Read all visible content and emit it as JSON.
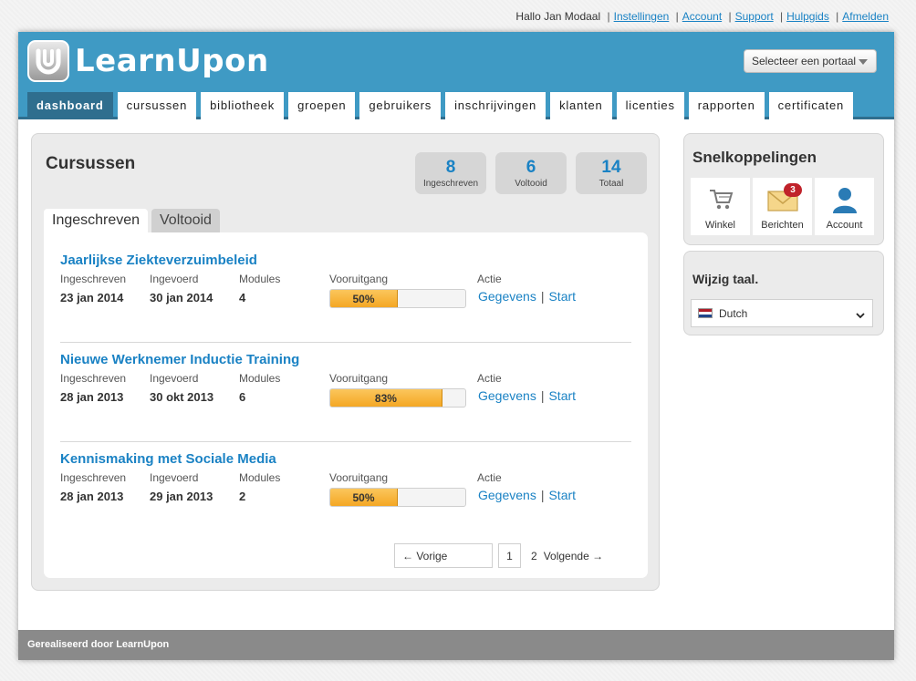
{
  "topbar": {
    "greeting": "Hallo Jan Modaal",
    "links": [
      "Instellingen",
      "Account",
      "Support",
      "Hulpgids",
      "Afmelden"
    ]
  },
  "header": {
    "logo_text": "LearnUpon",
    "portal_select": "Selecteer een portaal"
  },
  "nav": {
    "items": [
      "dashboard",
      "cursussen",
      "bibliotheek",
      "groepen",
      "gebruikers",
      "inschrijvingen",
      "klanten",
      "licenties",
      "rapporten",
      "certificaten"
    ],
    "active": "dashboard"
  },
  "courses_panel": {
    "title": "Cursussen",
    "stats": [
      {
        "value": "8",
        "label": "Ingeschreven"
      },
      {
        "value": "6",
        "label": "Voltooid"
      },
      {
        "value": "14",
        "label": "Totaal"
      }
    ],
    "tabs": [
      "Ingeschreven",
      "Voltooid"
    ],
    "columns": {
      "enrolled": "Ingeschreven",
      "entered": "Ingevoerd",
      "modules": "Modules",
      "progress": "Vooruitgang",
      "action": "Actie"
    },
    "actions": {
      "details": "Gegevens",
      "start": "Start"
    },
    "courses": [
      {
        "title": "Jaarlijkse Ziekteverzuimbeleid",
        "enrolled": "23 jan 2014",
        "entered": "30 jan 2014",
        "modules": "4",
        "progress_label": "50%",
        "progress": 0.5
      },
      {
        "title": "Nieuwe Werknemer Inductie Training",
        "enrolled": "28 jan 2013",
        "entered": "30 okt 2013",
        "modules": "6",
        "progress_label": "83%",
        "progress": 0.83
      },
      {
        "title": "Kennismaking met Sociale Media",
        "enrolled": "28 jan 2013",
        "entered": "29 jan 2013",
        "modules": "2",
        "progress_label": "50%",
        "progress": 0.5
      }
    ],
    "pagination": {
      "prev": "← Vorige",
      "page_current": "1",
      "page_next": "2",
      "next": "Volgende →"
    }
  },
  "shortcuts": {
    "title": "Snelkoppelingen",
    "items": [
      {
        "label": "Winkel",
        "icon": "cart-icon"
      },
      {
        "label": "Berichten",
        "icon": "envelope-icon",
        "badge": "3"
      },
      {
        "label": "Account",
        "icon": "user-icon"
      }
    ]
  },
  "language": {
    "title": "Wijzig taal.",
    "selected": "Dutch",
    "flag": "netherlands-flag-icon"
  },
  "footer": {
    "text": "Gerealiseerd door LearnUpon"
  },
  "colors": {
    "brand_blue": "#3f9ac4",
    "nav_active": "#2f6e8e",
    "link_blue": "#1a82c4",
    "progress_orange": "#f4a724",
    "badge_red": "#c0222a"
  }
}
